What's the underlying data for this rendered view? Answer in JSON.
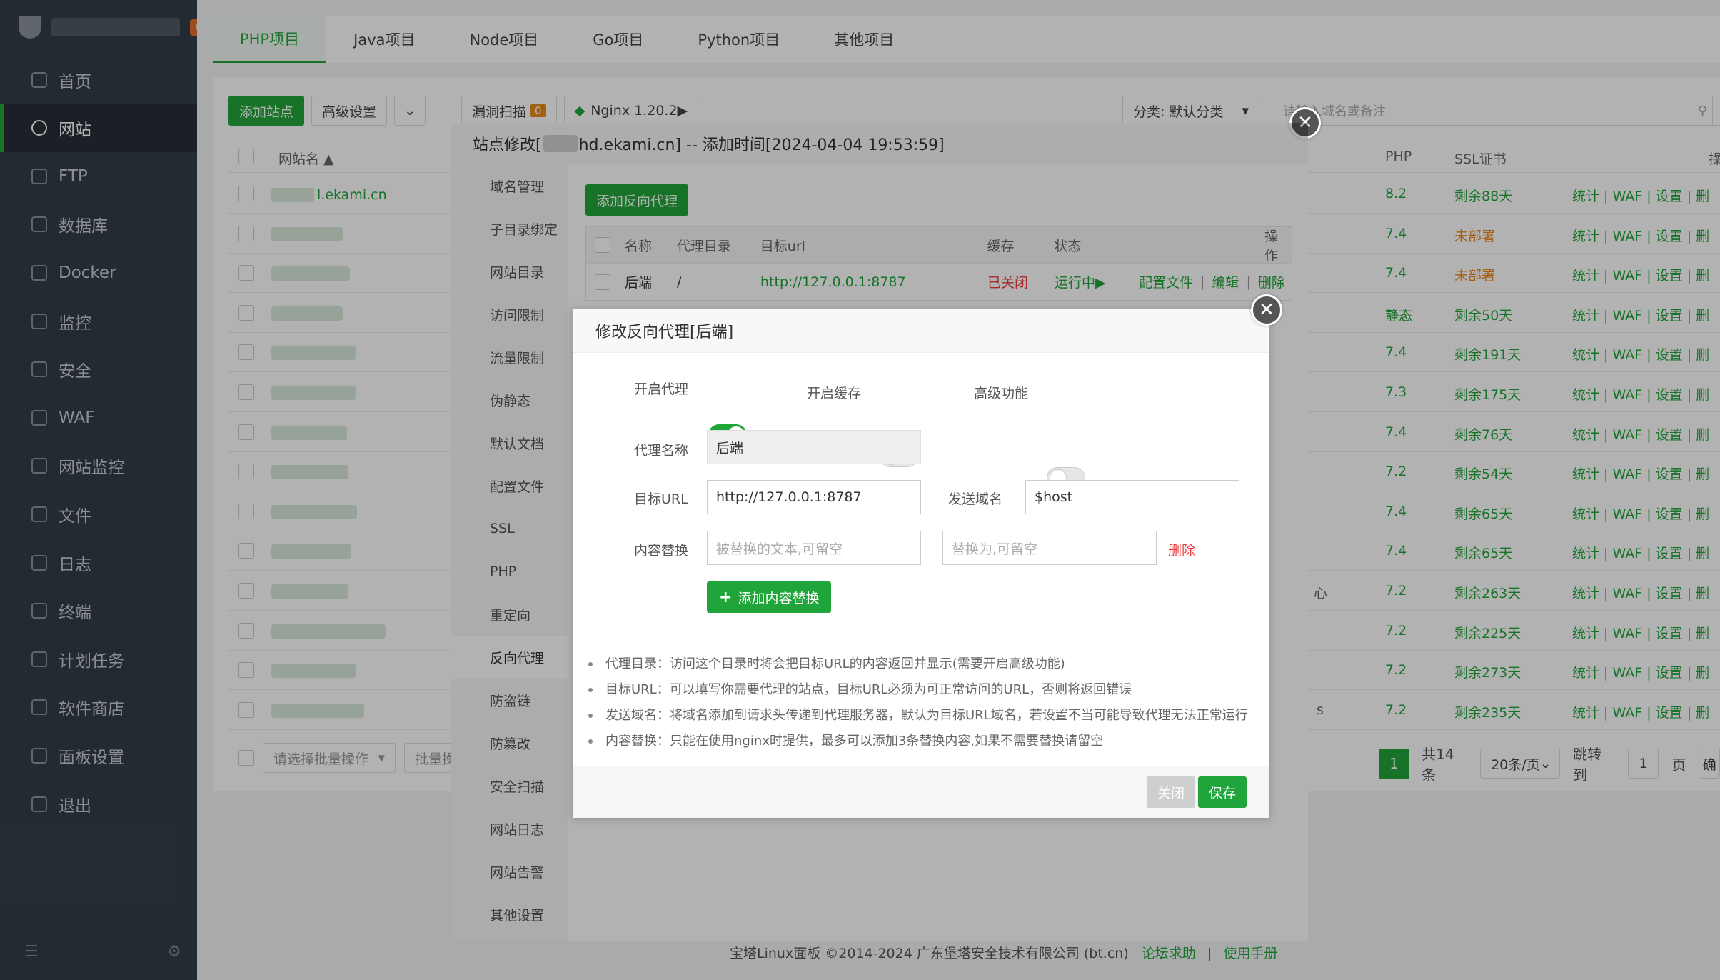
{
  "sidebar": {
    "badge": "0",
    "items": [
      {
        "label": "首页",
        "icon": "home-icon"
      },
      {
        "label": "网站",
        "icon": "globe-icon"
      },
      {
        "label": "FTP",
        "icon": "ftp-icon"
      },
      {
        "label": "数据库",
        "icon": "database-icon"
      },
      {
        "label": "Docker",
        "icon": "docker-icon"
      },
      {
        "label": "监控",
        "icon": "monitor-icon"
      },
      {
        "label": "安全",
        "icon": "shield-icon"
      },
      {
        "label": "WAF",
        "icon": "waf-icon"
      },
      {
        "label": "网站监控",
        "icon": "chart-icon"
      },
      {
        "label": "文件",
        "icon": "folder-icon"
      },
      {
        "label": "日志",
        "icon": "log-icon"
      },
      {
        "label": "终端",
        "icon": "terminal-icon"
      },
      {
        "label": "计划任务",
        "icon": "calendar-icon"
      },
      {
        "label": "软件商店",
        "icon": "apps-icon"
      },
      {
        "label": "面板设置",
        "icon": "gear-icon"
      },
      {
        "label": "退出",
        "icon": "logout-icon"
      }
    ]
  },
  "tabs": [
    "PHP项目",
    "Java项目",
    "Node项目",
    "Go项目",
    "Python项目",
    "其他项目"
  ],
  "toolbar": {
    "add_site": "添加站点",
    "advanced": "高级设置",
    "vuln_scan": "漏洞扫描",
    "vuln_count": "0",
    "nginx": "Nginx 1.20.2▶",
    "category": "分类: 默认分类",
    "search_placeholder": "请输入域名或备注"
  },
  "table": {
    "headers": {
      "name": "网站名 ▲",
      "php": "PHP",
      "ssl": "SSL证书",
      "ops": "操"
    },
    "first_name": "l.ekami.cn",
    "ops_text": "统计 | WAF | 设置 | 删",
    "rows": [
      {
        "php": "8.2",
        "ssl": "剩余88天"
      },
      {
        "php": "7.4",
        "ssl": "未部署"
      },
      {
        "php": "7.4",
        "ssl": "未部署"
      },
      {
        "php": "静态",
        "ssl": "剩余50天"
      },
      {
        "php": "7.4",
        "ssl": "剩余191天"
      },
      {
        "php": "7.3",
        "ssl": "剩余175天"
      },
      {
        "php": "7.4",
        "ssl": "剩余76天"
      },
      {
        "php": "7.2",
        "ssl": "剩余54天"
      },
      {
        "php": "7.4",
        "ssl": "剩余65天"
      },
      {
        "php": "7.4",
        "ssl": "剩余65天"
      },
      {
        "php": "7.2",
        "ssl": "剩余263天"
      },
      {
        "php": "7.2",
        "ssl": "剩余225天"
      },
      {
        "php": "7.2",
        "ssl": "剩余273天"
      },
      {
        "php": "7.2",
        "ssl": "剩余235天"
      }
    ],
    "row11_fragment": "心",
    "row14_fragment": "s"
  },
  "bottom": {
    "batch_placeholder": "请选择批量操作",
    "batch_btn": "批量操",
    "page": "1",
    "total": "共14条",
    "per_page": "20条/页",
    "jump": "跳转到",
    "jump_page": "1",
    "page_unit": "页",
    "confirm": "确"
  },
  "footer": {
    "copyright": "宝塔Linux面板 ©2014-2024 广东堡塔安全技术有限公司 (bt.cn)",
    "forum": "论坛求助",
    "manual": "使用手册"
  },
  "site_dialog": {
    "title_prefix": "站点修改[",
    "title_suffix": "hd.ekami.cn] -- 添加时间[2024-04-04 19:53:59]",
    "menu": [
      "域名管理",
      "子目录绑定",
      "网站目录",
      "访问限制",
      "流量限制",
      "伪静态",
      "默认文档",
      "配置文件",
      "SSL",
      "PHP",
      "重定向",
      "反向代理",
      "防盗链",
      "防篡改",
      "安全扫描",
      "网站日志",
      "网站告警",
      "其他设置"
    ],
    "add_proxy": "添加反向代理",
    "proxy_headers": {
      "name": "名称",
      "dir": "代理目录",
      "url": "目标url",
      "cache": "缓存",
      "status": "状态",
      "ops": "操作"
    },
    "proxy_row": {
      "name": "后端",
      "dir": "/",
      "url": "http://127.0.0.1:8787",
      "cache": "已关闭",
      "status": "运行中▶",
      "config": "配置文件",
      "edit": "编辑",
      "delete": "删除"
    }
  },
  "proxy_dialog": {
    "title": "修改反向代理[后端]",
    "enable_proxy": "开启代理",
    "enable_cache": "开启缓存",
    "advanced": "高级功能",
    "proxy_on": true,
    "cache_on": false,
    "advanced_on": false,
    "name_label": "代理名称",
    "name_value": "后端",
    "url_label": "目标URL",
    "url_value": "http://127.0.0.1:8787",
    "host_label": "发送域名",
    "host_value": "$host",
    "replace_label": "内容替换",
    "replace_from_placeholder": "被替换的文本,可留空",
    "replace_to_placeholder": "替换为,可留空",
    "replace_delete": "删除",
    "add_replace": "添加内容替换",
    "tips": [
      "代理目录：访问这个目录时将会把目标URL的内容返回并显示(需要开启高级功能)",
      "目标URL：可以填写你需要代理的站点，目标URL必须为可正常访问的URL，否则将返回错误",
      "发送域名：将域名添加到请求头传递到代理服务器，默认为目标URL域名，若设置不当可能导致代理无法正常运行",
      "内容替换：只能在使用nginx时提供，最多可以添加3条替换内容,如果不需要替换请留空"
    ],
    "close": "关闭",
    "save": "保存"
  },
  "colors": {
    "accent": "#20a53a",
    "sidebar": "#333d47",
    "warning": "#e88a1a",
    "danger": "#ef3b3b"
  }
}
